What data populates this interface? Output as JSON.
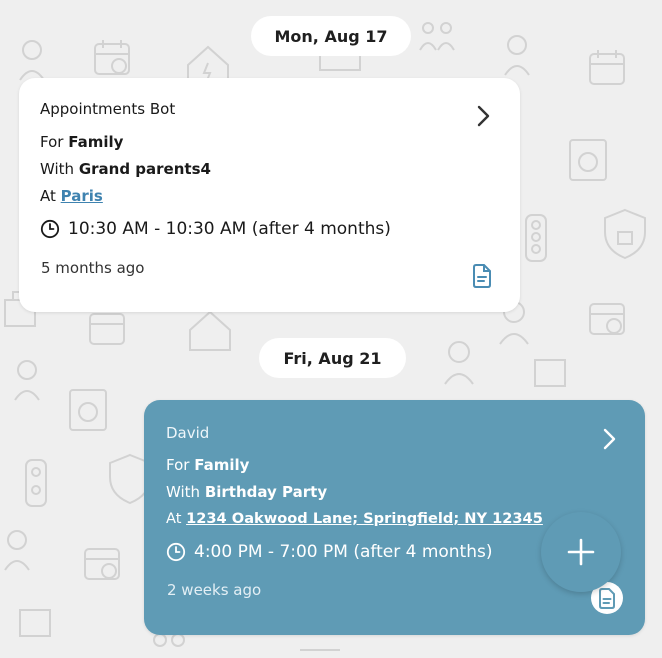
{
  "messages": [
    {
      "date": "Mon, Aug 17",
      "sender": "Appointments Bot",
      "for_prefix": "For ",
      "for_value": "Family",
      "with_prefix": "With ",
      "with_value": "Grand parents4",
      "at_prefix": "At ",
      "at_value": "Paris",
      "time": "10:30 AM - 10:30 AM  (after 4 months)",
      "ago": "5 months ago"
    },
    {
      "date": "Fri, Aug 21",
      "sender": "David",
      "for_prefix": "For ",
      "for_value": "Family",
      "with_prefix": "With ",
      "with_value": "Birthday Party",
      "at_prefix": "At ",
      "at_value": "1234 Oakwood Lane; Springfield; NY 12345",
      "time": "4:00 PM - 7:00 PM  (after 4 months)",
      "ago": "2 weeks ago"
    }
  ],
  "icons": {
    "open_details": "chevron-right-icon",
    "attachment": "document-icon",
    "time": "clock-icon",
    "add": "plus-icon"
  },
  "colors": {
    "background": "#efefef",
    "incoming_card": "#ffffff",
    "outgoing_card": "#5f9bb5",
    "link": "#3f83b0",
    "fab": "#5f9bb5"
  }
}
